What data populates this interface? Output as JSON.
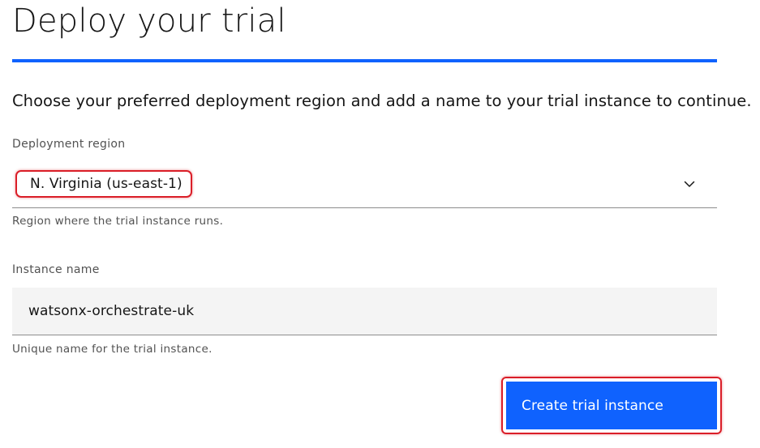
{
  "page": {
    "title": "Deploy your trial",
    "intro": "Choose your preferred deployment region and add a name to your trial instance to continue."
  },
  "region": {
    "label": "Deployment region",
    "selected": "N. Virginia (us-east-1)",
    "helper": "Region where the trial instance runs.",
    "icon": "chevron-down-icon"
  },
  "instance": {
    "label": "Instance name",
    "value": "watsonx-orchestrate-uk",
    "helper": "Unique name for the trial instance."
  },
  "actions": {
    "create_label": "Create trial instance"
  },
  "colors": {
    "accent": "#0f62fe",
    "highlight": "#da1e28",
    "input_bg": "#f4f4f4",
    "text_primary": "#161616",
    "text_secondary": "#525252"
  }
}
